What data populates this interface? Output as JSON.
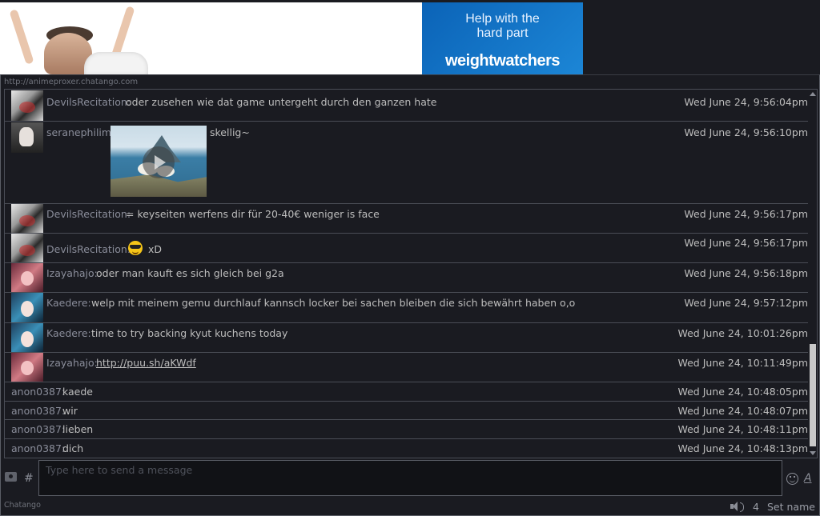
{
  "ad": {
    "tagline": "Help with the hard part",
    "logo": "weightwatchers",
    "brand_color": "#0b63b7"
  },
  "url": "http://animeproxer.chatango.com",
  "messages": [
    {
      "user": "DevilsRecitation:",
      "text": "oder zusehen wie dat game untergeht durch den ganzen hate",
      "time": "Wed June 24, 9:56:04pm",
      "avatar": "devilsrecitation-avatar"
    },
    {
      "user": "seranephilim:",
      "text": "skellig~",
      "time": "Wed June 24, 9:56:10pm",
      "avatar": "seranephilim-avatar",
      "media": "video-thumbnail"
    },
    {
      "user": "DevilsRecitation:",
      "text": "= keyseiten werfens dir für 20-40€ weniger is face",
      "time": "Wed June 24, 9:56:17pm",
      "avatar": "devilsrecitation-avatar"
    },
    {
      "user": "DevilsRecitation:",
      "text": "xD",
      "time": "Wed June 24, 9:56:17pm",
      "avatar": "devilsrecitation-avatar",
      "emoji": "sunglasses-emoji"
    },
    {
      "user": "Izayahajo:",
      "text": "oder man kauft es sich gleich bei g2a",
      "time": "Wed June 24, 9:56:18pm",
      "avatar": "izayahajo-avatar"
    },
    {
      "user": "Kaedere:",
      "text": "welp mit meinem gemu durchlauf kannsch locker bei sachen bleiben die sich bewährt haben o,o",
      "time": "Wed June 24, 9:57:12pm",
      "avatar": "kaedere-avatar"
    },
    {
      "user": "Kaedere:",
      "text": "time to try backing kyut kuchens today",
      "time": "Wed June 24, 10:01:26pm",
      "avatar": "kaedere-avatar"
    },
    {
      "user": "Izayahajo:",
      "text": "http://puu.sh/aKWdf",
      "time": "Wed June 24, 10:11:49pm",
      "avatar": "izayahajo-avatar"
    },
    {
      "user": "anon0387:",
      "text": "kaede",
      "time": "Wed June 24, 10:48:05pm"
    },
    {
      "user": "anon0387:",
      "text": "wir",
      "time": "Wed June 24, 10:48:07pm"
    },
    {
      "user": "anon0387:",
      "text": "lieben",
      "time": "Wed June 24, 10:48:11pm"
    },
    {
      "user": "anon0387:",
      "text": "dich",
      "time": "Wed June 24, 10:48:13pm"
    }
  ],
  "composer": {
    "placeholder": "Type here to send a message",
    "hash": "#",
    "font_button": "A"
  },
  "footer": {
    "brand": "Chatango",
    "user_count": "4",
    "set_name": "Set name"
  }
}
